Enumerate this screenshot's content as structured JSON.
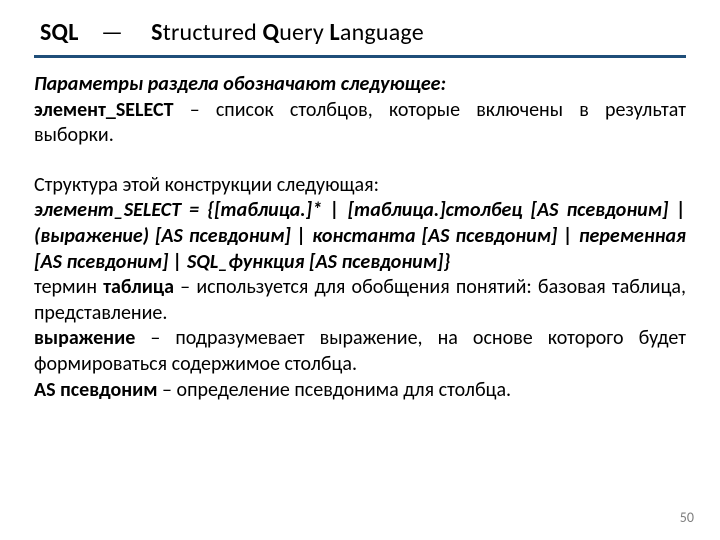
{
  "title": {
    "sql_bold": "SQL",
    "dash": "—",
    "s": "S",
    "structured": "tructured ",
    "q": "Q",
    "query": "uery ",
    "l": "L",
    "language": "anguage"
  },
  "body": {
    "heading": "Параметры раздела обозначают следующее:",
    "p1_term": "элемент_SELECT",
    "p1_rest": " – список столбцов, которые включены в результат выборки.",
    "struct_label": "Структура этой конструкции следующая:",
    "syntax": "элемент_SELECT = {[таблица.]* | [таблица.]столбец [AS псевдоним] | (выражение) [AS псевдоним] | константа [AS псевдоним] | переменная [AS псевдоним] | SQL_функция [AS псевдоним]}",
    "p2_pre": "термин ",
    "p2_term": "таблица",
    "p2_rest": " – используется для обобщения понятий: базовая таблица, представление.",
    "p3_term": "выражение",
    "p3_rest": " – подразумевает выражение, на основе которого будет формироваться содержимое столбца.",
    "p4_term": "AS псевдоним",
    "p4_rest": " – определение псевдонима для столбца."
  },
  "page_number": "50"
}
